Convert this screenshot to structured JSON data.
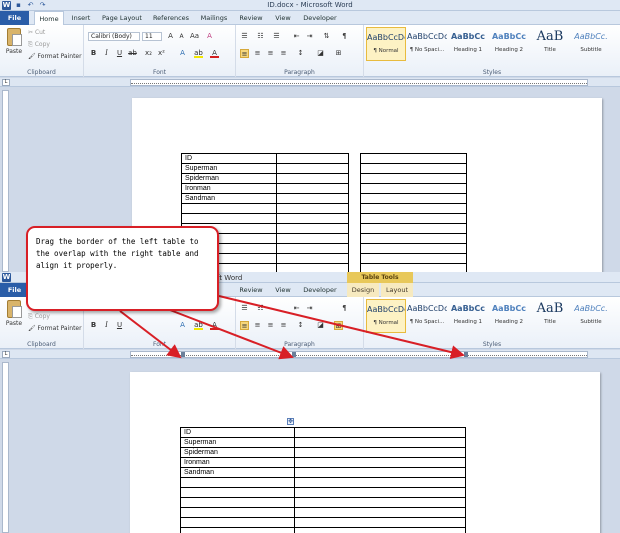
{
  "top": {
    "title": "ID.docx - Microsoft Word",
    "tabs": [
      "File",
      "Home",
      "Insert",
      "Page Layout",
      "References",
      "Mailings",
      "Review",
      "View",
      "Developer"
    ],
    "clipboard": {
      "paste": "Paste",
      "cut": "Cut",
      "copy": "Copy",
      "format_painter": "Format Painter",
      "label": "Clipboard"
    },
    "font": {
      "name": "Calibri (Body)",
      "size": "11",
      "label": "Font"
    },
    "paragraph_label": "Paragraph",
    "styles_label": "Styles",
    "styles": [
      {
        "preview": "AaBbCcDc",
        "name": "¶ Normal"
      },
      {
        "preview": "AaBbCcDc",
        "name": "¶ No Spaci..."
      },
      {
        "preview": "AaBbCc",
        "name": "Heading 1"
      },
      {
        "preview": "AaBbCc",
        "name": "Heading 2"
      },
      {
        "preview": "AaB",
        "name": "Title"
      },
      {
        "preview": "AaBbCc.",
        "name": "Subtitle"
      }
    ],
    "table_rows": [
      "ID",
      "Superman",
      "Spiderman",
      "Ironman",
      "Sandman",
      "",
      "",
      "",
      "",
      "",
      "",
      "",
      "",
      ""
    ]
  },
  "bottom": {
    "title_fragment": "ft Word",
    "context_tab": "Table Tools",
    "tabs_right": [
      "Review",
      "View",
      "Developer",
      "Design",
      "Layout"
    ],
    "clipboard": {
      "paste": "Paste",
      "copy": "Copy",
      "format_painter": "Format Painter",
      "label": "Clipboard"
    },
    "font_label": "Font",
    "paragraph_label": "Paragraph",
    "styles_label": "Styles",
    "styles": [
      {
        "preview": "AaBbCcDc",
        "name": "¶ Normal"
      },
      {
        "preview": "AaBbCcDc",
        "name": "¶ No Spaci..."
      },
      {
        "preview": "AaBbCc",
        "name": "Heading 1"
      },
      {
        "preview": "AaBbCc",
        "name": "Heading 2"
      },
      {
        "preview": "AaB",
        "name": "Title"
      },
      {
        "preview": "AaBbCc.",
        "name": "Subtitle"
      }
    ],
    "table_rows": [
      "ID",
      "Superman",
      "Spiderman",
      "Ironman",
      "Sandman",
      "",
      "",
      "",
      "",
      "",
      ""
    ]
  },
  "callout": {
    "text": "Drag the border of the left table to the overlap with the right table and align it properly."
  },
  "colors": {
    "callout_border": "#d81f26",
    "arrow": "#d81f26",
    "file_tab": "#2a5da8"
  }
}
